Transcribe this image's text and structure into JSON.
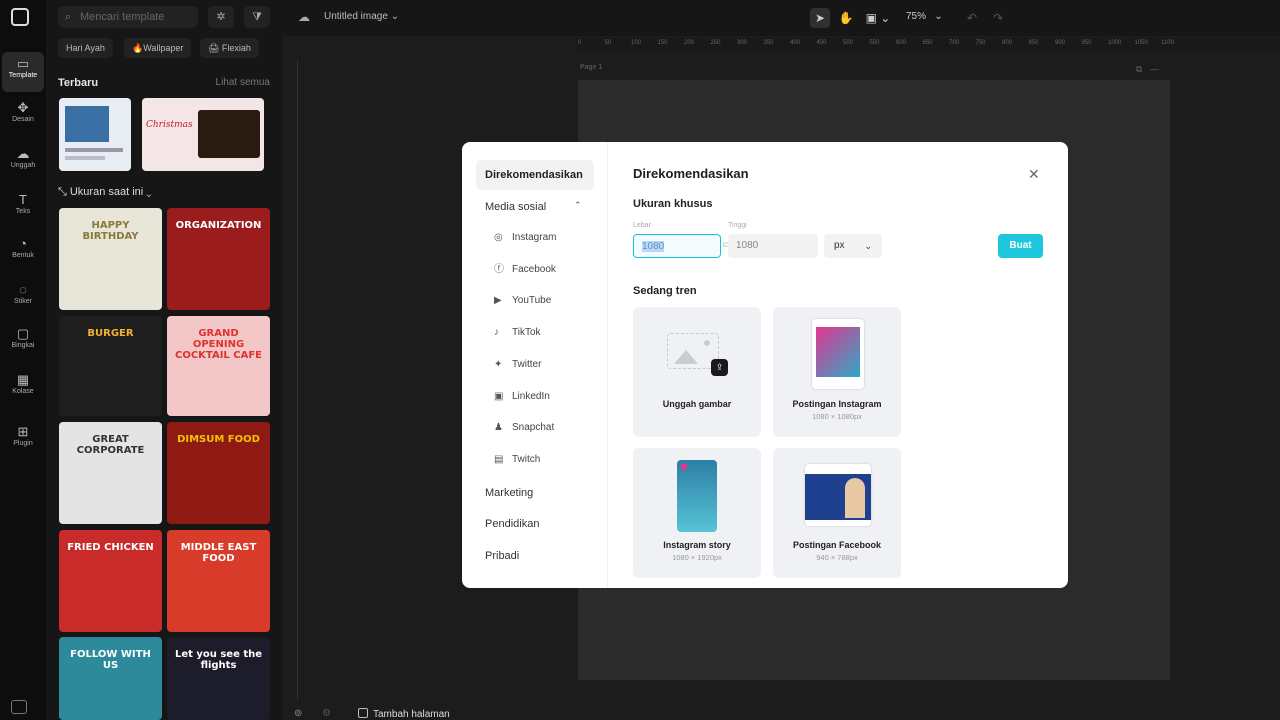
{
  "rail": {
    "items": [
      {
        "label": "Template",
        "icon": "template-icon"
      },
      {
        "label": "Desain",
        "icon": "design-icon"
      },
      {
        "label": "Unggah",
        "icon": "upload-icon"
      },
      {
        "label": "Teks",
        "icon": "text-icon"
      },
      {
        "label": "Bentuk",
        "icon": "shape-icon"
      },
      {
        "label": "Stiker",
        "icon": "sticker-icon"
      },
      {
        "label": "Bingkai",
        "icon": "frame-icon"
      },
      {
        "label": "Kolase",
        "icon": "collage-icon"
      },
      {
        "label": "Plugin",
        "icon": "plugin-icon"
      }
    ]
  },
  "panel": {
    "search_placeholder": "Mencari template",
    "chips": [
      "Hari Ayah",
      "🔥Wallpaper",
      "🖨 Flexiah"
    ],
    "recent_title": "Terbaru",
    "see_all": "Lihat semua",
    "size_title": "Ukuran saat ini",
    "thumbs": [
      {
        "text": "HAPPY BIRTHDAY",
        "bg": "#e8e6d8",
        "fg": "#8a7a3a"
      },
      {
        "text": "ORGANIZATION",
        "bg": "#9b1c1c",
        "fg": "#ffffff"
      },
      {
        "text": "BURGER",
        "bg": "#1e1e1e",
        "fg": "#f2b233"
      },
      {
        "text": "GRAND OPENING COCKTAIL CAFE",
        "bg": "#f3c7c7",
        "fg": "#e0322f"
      },
      {
        "text": "GREAT CORPORATE",
        "bg": "#e4e4e4",
        "fg": "#333333"
      },
      {
        "text": "DIMSUM FOOD",
        "bg": "#8f1a14",
        "fg": "#f2c200"
      },
      {
        "text": "FRIED CHICKEN",
        "bg": "#c92a2a",
        "fg": "#ffffff"
      },
      {
        "text": "MIDDLE EAST FOOD",
        "bg": "#d93b2b",
        "fg": "#ffffff"
      },
      {
        "text": "FOLLOW WITH US",
        "bg": "#2d8a9a",
        "fg": "#ffffff"
      },
      {
        "text": "Let you see the flights",
        "bg": "#1c1c2a",
        "fg": "#ffffff"
      }
    ]
  },
  "topbar": {
    "doc_title": "Untitled image",
    "zoom": "75%"
  },
  "ruler_ticks": [
    "0",
    "50",
    "100",
    "150",
    "200",
    "250",
    "300",
    "350",
    "400",
    "450",
    "500",
    "550",
    "600",
    "650",
    "700",
    "750",
    "800",
    "850",
    "900",
    "950",
    "1000",
    "1050",
    "1100"
  ],
  "page_label": "Page 1",
  "bottom": {
    "add_page": "Tambah halaman"
  },
  "modal": {
    "nav": {
      "recommended": "Direkomendasikan",
      "social": "Media sosial",
      "marketing": "Marketing",
      "education": "Pendidikan",
      "personal": "Pribadi",
      "social_items": [
        "Instagram",
        "Facebook",
        "YouTube",
        "TikTok",
        "Twitter",
        "LinkedIn",
        "Snapchat",
        "Twitch"
      ]
    },
    "title": "Direkomendasikan",
    "custom_size": "Ukuran khusus",
    "width_label": "Lebar",
    "height_label": "Tinggi",
    "width_value": "1080",
    "height_value": "1080",
    "unit": "px",
    "create": "Buat",
    "trending": "Sedang tren",
    "cards": [
      {
        "label": "Unggah gambar",
        "dim": ""
      },
      {
        "label": "Postingan Instagram",
        "dim": "1080 × 1080px"
      },
      {
        "label": "Instagram story",
        "dim": "1080 × 1920px"
      },
      {
        "label": "Postingan Facebook",
        "dim": "940 × 788px"
      }
    ]
  }
}
